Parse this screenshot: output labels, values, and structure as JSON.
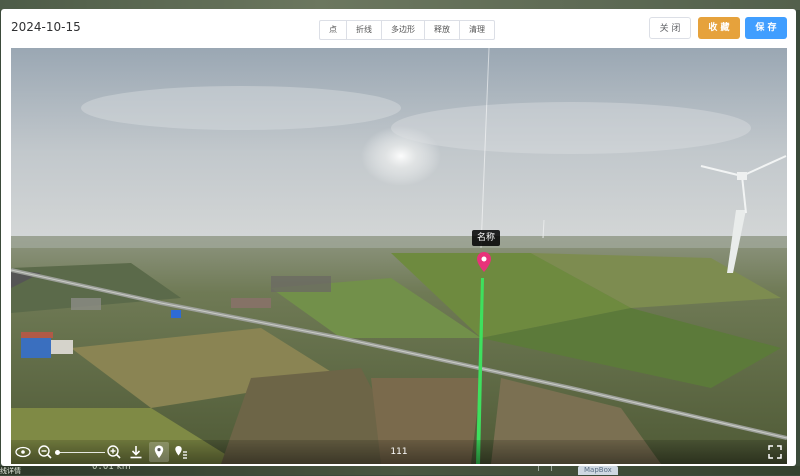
{
  "dialog": {
    "date": "2024-10-15",
    "tools": [
      "点",
      "折线",
      "多边形",
      "释放",
      "清理"
    ],
    "buttons": {
      "close": "关 闭",
      "favorite": "收 藏",
      "save": "保 存"
    },
    "colors": {
      "favorite": "#e6a23c",
      "save": "#409eff",
      "marker": "#e8327a",
      "line": "#3ee05e"
    }
  },
  "viewer": {
    "marker_label": "名称",
    "caption": "111",
    "controls": [
      "eye-icon",
      "zoom-out-icon",
      "zoom-slider",
      "zoom-in-icon",
      "download-icon",
      "location-pin-icon",
      "pin-list-icon",
      "fullscreen-icon"
    ]
  },
  "background": {
    "scale_value": "0.01",
    "scale_unit": "km",
    "side_text": "线详情",
    "tag_text": "MapBox"
  }
}
